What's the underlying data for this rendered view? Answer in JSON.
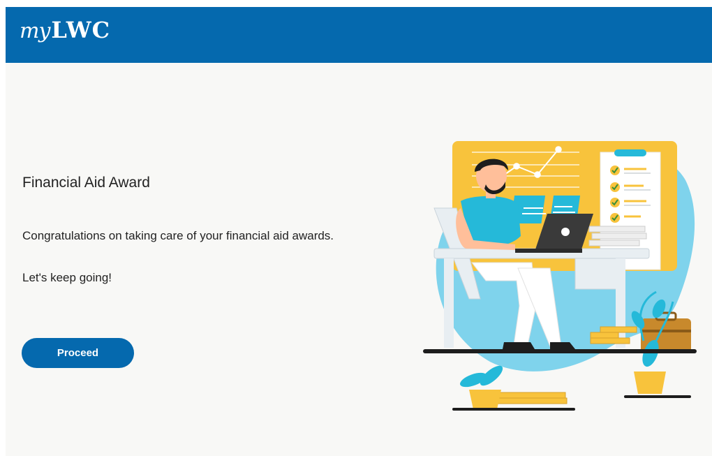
{
  "header": {
    "logo_prefix": "my",
    "logo_name": "LWC"
  },
  "main": {
    "title": "Financial Aid Award",
    "message": "Congratulations on taking care of your financial aid awards.",
    "submessage": "Let's keep going!",
    "proceed_label": "Proceed"
  },
  "colors": {
    "brand_blue": "#0569ae",
    "background": "#f8f8f6",
    "illustration_yellow": "#f8c33c",
    "illustration_teal": "#7fd3ec"
  },
  "illustration": {
    "icon": "person-at-desk-with-laptop-illustration"
  }
}
